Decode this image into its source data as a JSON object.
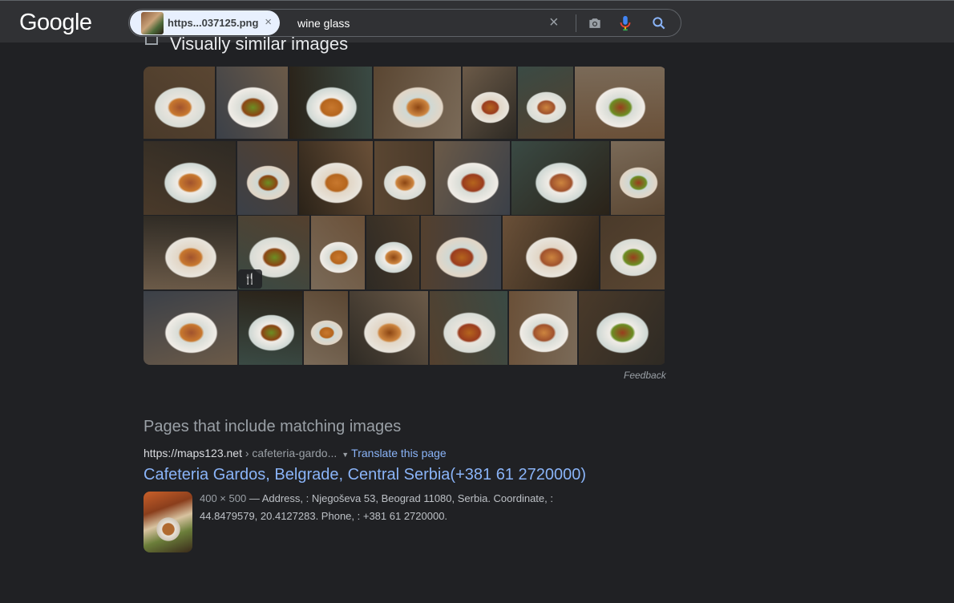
{
  "header": {
    "logo": "Google",
    "chip_label": "https...037125.png",
    "chip_close": "×",
    "query": "wine glass",
    "clear": "×"
  },
  "similar": {
    "title": "Visually similar images",
    "feedback": "Feedback",
    "badge_icon": "fork-knife-icon"
  },
  "pages": {
    "title": "Pages that include matching images",
    "result": {
      "site": "https://maps123.net",
      "path": " › cafeteria-gardo...",
      "caret": "▼",
      "translate": "Translate this page",
      "title": "Cafeteria Gardos, Belgrade, Central Serbia(+381 61 2720000)",
      "dims": "400 × 500",
      "snippet_line1": " — Address, : Njegoševa 53, Beograd 11080, Serbia. Coordinate, :",
      "snippet_line2": "44.8479579, 20.4127283. Phone, : +381 61 2720000."
    }
  }
}
